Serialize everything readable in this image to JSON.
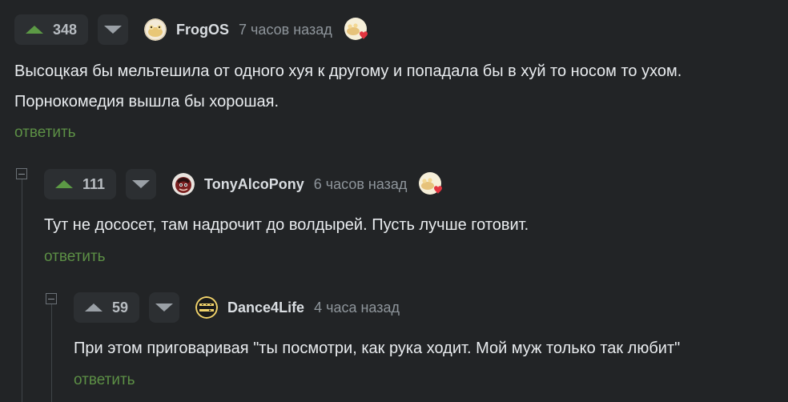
{
  "colors": {
    "background": "#222426",
    "upvote": "#5c9a45",
    "reply_link": "#5c8f45",
    "muted": "#8e959b"
  },
  "comments": [
    {
      "rating": "348",
      "author": "FrogOS",
      "time": "7 часов назад",
      "lines": [
        "Высоцкая бы мельтешила от одного хуя к другому и попадала бы в хуй то носом то ухом.",
        "Порнокомедия вышла бы хорошая."
      ],
      "reply_label": "ответить",
      "avatar_icon": "frog-avatar-icon",
      "award_icon": "heart-award-icon"
    },
    {
      "rating": "111",
      "author": "TonyAlcoPony",
      "time": "6 часов назад",
      "lines": [
        "Тут не дососет, там надрочит до волдырей. Пусть лучше готовит."
      ],
      "reply_label": "ответить",
      "avatar_icon": "pony-avatar-icon",
      "award_icon": "heart-award-icon"
    },
    {
      "rating": "59",
      "author": "Dance4Life",
      "time": "4 часа назад",
      "lines": [
        "При этом приговаривая \"ты посмотри, как рука ходит. Мой муж только так любит\""
      ],
      "reply_label": "ответить",
      "avatar_icon": "dance-avatar-icon"
    }
  ]
}
